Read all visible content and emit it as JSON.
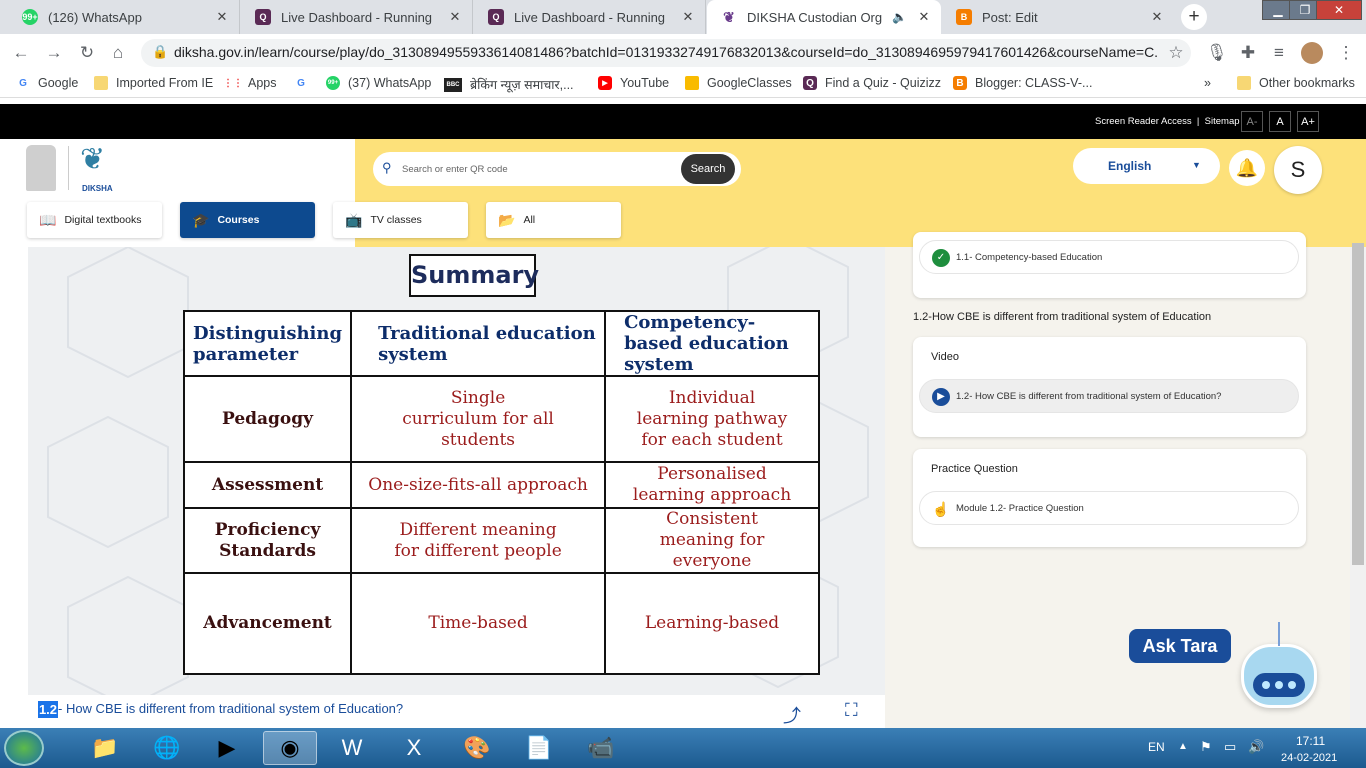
{
  "tabs": [
    {
      "title": "(126) WhatsApp",
      "badge": "99+",
      "icon": "whatsapp-icon"
    },
    {
      "title": "Live Dashboard - Running",
      "icon": "quizizz-icon"
    },
    {
      "title": "Live Dashboard - Running",
      "icon": "quizizz-icon"
    },
    {
      "title": "DIKSHA Custodian Org",
      "icon": "diksha-icon"
    },
    {
      "title": "Post: Edit",
      "icon": "blogger-icon"
    }
  ],
  "address": {
    "url": "diksha.gov.in/learn/course/play/do_3130894955933614081486?batchId=01319332749176832013&courseId=do_3130894695979417601426&courseName=C..."
  },
  "bookmarks": [
    {
      "label": "Google"
    },
    {
      "label": "Imported From IE"
    },
    {
      "label": "Apps"
    },
    {
      "label": "(37) WhatsApp"
    },
    {
      "label": "ब्रेकिंग न्यूज़ समाचार,..."
    },
    {
      "label": "YouTube"
    },
    {
      "label": "GoogleClasses"
    },
    {
      "label": "Find a Quiz - Quizizz"
    },
    {
      "label": "Blogger: CLASS-V-..."
    },
    {
      "label": "Other bookmarks"
    }
  ],
  "site": {
    "access_links": "Screen Reader Access  |  Sitemap",
    "font_small": "A-",
    "font_normal": "A",
    "font_large": "A+",
    "brand": "DIKSHA",
    "search_placeholder": "Search or enter QR code",
    "search_button": "Search",
    "language": "English",
    "avatar_letter": "S",
    "nav": [
      {
        "label": "Digital textbooks"
      },
      {
        "label": "Courses"
      },
      {
        "label": "TV classes"
      },
      {
        "label": "All"
      }
    ]
  },
  "slide": {
    "title": "Summary",
    "headers": [
      "Distinguishing parameter",
      "Traditional education system",
      "Competency-based education system"
    ],
    "rows": [
      {
        "param": "Pedagogy",
        "traditional": "Single curriculum for all students",
        "cbe": "Individual learning pathway for each student"
      },
      {
        "param": "Assessment",
        "traditional": "One-size-fits-all approach",
        "cbe": "Personalised learning approach"
      },
      {
        "param": "Proficiency Standards",
        "traditional": "Different meaning for different people",
        "cbe": "Consistent meaning for everyone"
      },
      {
        "param": "Advancement",
        "traditional": "Time-based",
        "cbe": "Learning-based"
      }
    ]
  },
  "player": {
    "number": "1.2",
    "caption": "- How CBE is different from traditional system of Education?"
  },
  "toc": {
    "prev_item": "1.1- Competency-based Education",
    "section_title": "1.2-How CBE is different from traditional system of Education",
    "video_label": "Video",
    "video_item": "1.2- How CBE is different from traditional system of Education?",
    "practice_label": "Practice Question",
    "practice_item": "Module 1.2- Practice Question"
  },
  "assistant": {
    "label": "Ask Tara"
  },
  "tray": {
    "lang": "EN",
    "time": "17:11",
    "date": "24-02-2021"
  }
}
